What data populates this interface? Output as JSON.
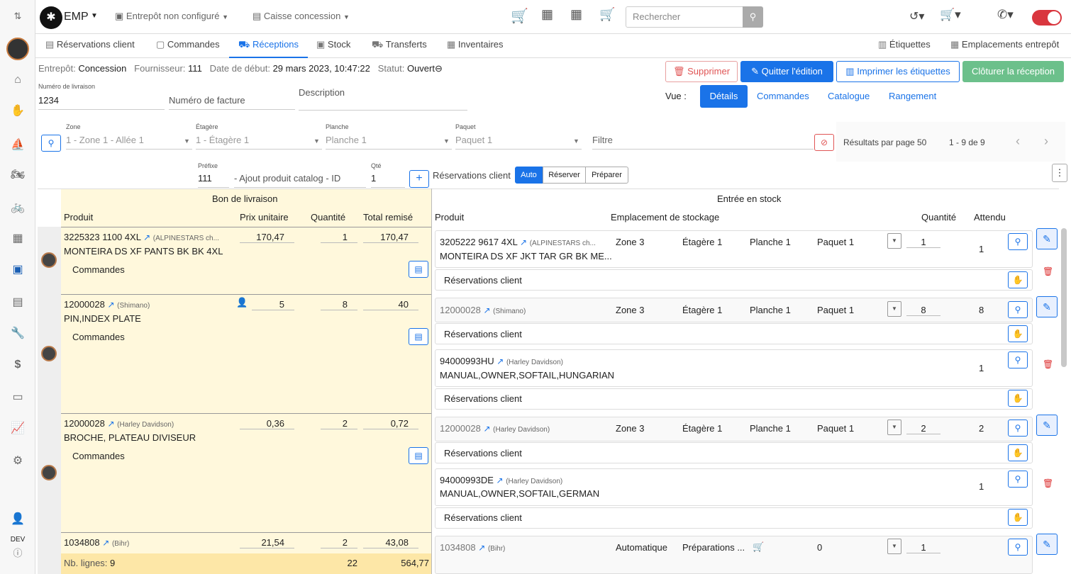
{
  "app": {
    "title": "EMP",
    "warehouse": "Entrepôt non configuré",
    "register": "Caisse concession",
    "search_placeholder": "Rechercher",
    "dev": "DEV"
  },
  "tabs": [
    {
      "label": "Réservations client"
    },
    {
      "label": "Commandes"
    },
    {
      "label": "Réceptions"
    },
    {
      "label": "Stock"
    },
    {
      "label": "Transferts"
    },
    {
      "label": "Inventaires"
    }
  ],
  "right_tabs": {
    "labels": "Étiquettes",
    "locations": "Emplacements entrepôt"
  },
  "info": {
    "warehouse_label": "Entrepôt:",
    "warehouse": "Concession",
    "supplier_label": "Fournisseur:",
    "supplier": "111",
    "start_label": "Date de début:",
    "start": "29 mars 2023, 10:47:22",
    "status_label": "Statut:",
    "status": "Ouvert"
  },
  "actions": {
    "delete": "Supprimer",
    "quit": "Quitter l'édition",
    "print": "Imprimer les étiquettes",
    "close": "Clôturer la réception"
  },
  "fields": {
    "delivery_label": "Numéro de livraison",
    "delivery": "1234",
    "invoice_placeholder": "Numéro de facture",
    "description_label": "Description"
  },
  "view": {
    "label": "Vue :",
    "options": [
      "Détails",
      "Commandes",
      "Catalogue",
      "Rangement"
    ],
    "active": "Détails"
  },
  "filters": {
    "zone_label": "Zone",
    "zone": "1 - Zone 1 - Allée 1",
    "shelf_label": "Étagère",
    "shelf": "1 - Étagère 1",
    "plank_label": "Planche",
    "plank": "Planche 1",
    "package_label": "Paquet",
    "package": "Paquet 1",
    "filter_placeholder": "Filtre",
    "per_page_label": "Résultats par page",
    "per_page": "50",
    "range": "1 - 9 de 9"
  },
  "add": {
    "prefix_label": "Préfixe",
    "prefix": "111",
    "product_placeholder": "Ajout produit catalog - ID",
    "qty_label": "Qté",
    "qty": "1",
    "reservations_label": "Réservations client",
    "modes": [
      "Auto",
      "Réserver",
      "Préparer"
    ]
  },
  "left_header": {
    "section": "Bon de livraison",
    "product": "Produit",
    "unit_price": "Prix unitaire",
    "quantity": "Quantité",
    "total": "Total remisé"
  },
  "right_header": {
    "section": "Entrée en stock",
    "product": "Produit",
    "location": "Emplacement de stockage",
    "quantity": "Quantité",
    "expected": "Attendu"
  },
  "commandes_label": "Commandes",
  "reservations_label": "Réservations client",
  "rows": [
    {
      "code": "3225323 1100 4XL",
      "brand": "(ALPINESTARS ch...",
      "name": "MONTEIRA DS XF PANTS BK BK 4XL",
      "price": "170,47",
      "qty": "1",
      "total": "170,47",
      "entries": [
        {
          "code": "3205222 9617 4XL",
          "brand": "(ALPINESTARS ch...",
          "name": "MONTEIRA DS XF JKT TAR GR BK ME...",
          "zone": "Zone 3",
          "shelf": "Étagère 1",
          "plank": "Planche 1",
          "package": "Paquet 1",
          "qty": "1",
          "expected": "1"
        }
      ]
    },
    {
      "code": "12000028",
      "brand": "(Shimano)",
      "name": "PIN,INDEX PLATE",
      "price": "5",
      "qty": "8",
      "total": "40",
      "entries": [
        {
          "code": "12000028",
          "brand": "(Shimano)",
          "zone": "Zone 3",
          "shelf": "Étagère 1",
          "plank": "Planche 1",
          "package": "Paquet 1",
          "qty": "8",
          "expected": "8"
        },
        {
          "code": "94000993HU",
          "brand": "(Harley Davidson)",
          "name": "MANUAL,OWNER,SOFTAIL,HUNGARIAN",
          "expected": "1"
        }
      ]
    },
    {
      "code": "12000028",
      "brand": "(Harley Davidson)",
      "name": "BROCHE, PLATEAU DIVISEUR",
      "price": "0,36",
      "qty": "2",
      "total": "0,72",
      "entries": [
        {
          "code": "12000028",
          "brand": "(Harley Davidson)",
          "zone": "Zone 3",
          "shelf": "Étagère 1",
          "plank": "Planche 1",
          "package": "Paquet 1",
          "qty": "2",
          "expected": "2"
        },
        {
          "code": "94000993DE",
          "brand": "(Harley Davidson)",
          "name": "MANUAL,OWNER,SOFTAIL,GERMAN",
          "expected": "1"
        }
      ]
    },
    {
      "code": "1034808",
      "brand": "(Bihr)",
      "price": "21,54",
      "qty": "2",
      "total": "43,08",
      "entries": [
        {
          "code": "1034808",
          "brand": "(Bihr)",
          "zone": "Automatique",
          "shelf": "Préparations ...",
          "plank": "0",
          "qty": "1"
        }
      ]
    }
  ],
  "footer": {
    "label": "Nb. lignes:",
    "count": "9",
    "qty": "22",
    "total": "564,77"
  }
}
